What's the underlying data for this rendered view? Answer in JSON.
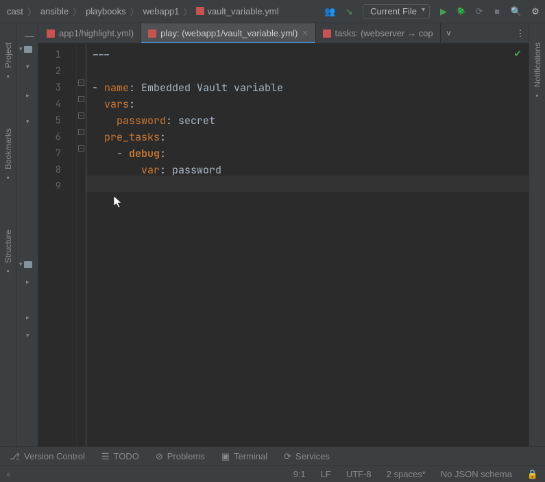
{
  "breadcrumbs": [
    "cast",
    "ansible",
    "playbooks",
    "webapp1",
    "vault_variable.yml"
  ],
  "run_config": "Current File",
  "tabs": [
    {
      "label": "app1/highlight.yml)",
      "active": false
    },
    {
      "label": "play: (webapp1/vault_variable.yml)",
      "active": true
    },
    {
      "label": "tasks: (webserver → cop",
      "active": false
    }
  ],
  "left_tools": [
    "Project",
    "Bookmarks",
    "Structure"
  ],
  "right_tools": [
    "Notifications"
  ],
  "code_lines": [
    {
      "n": 1,
      "tokens": [
        {
          "cls": "tok-dash",
          "t": "---"
        }
      ]
    },
    {
      "n": 2,
      "tokens": []
    },
    {
      "n": 3,
      "fold": true,
      "tokens": [
        {
          "cls": "tok-dash",
          "t": "- "
        },
        {
          "cls": "tok-key",
          "t": "name"
        },
        {
          "cls": "tok-val",
          "t": ": Embedded Vault variable"
        }
      ]
    },
    {
      "n": 4,
      "fold": true,
      "tokens": [
        {
          "cls": "tok-dash",
          "t": "  "
        },
        {
          "cls": "tok-key",
          "t": "vars"
        },
        {
          "cls": "tok-val",
          "t": ":"
        }
      ]
    },
    {
      "n": 5,
      "fold": true,
      "tokens": [
        {
          "cls": "tok-dash",
          "t": "    "
        },
        {
          "cls": "tok-key",
          "t": "password"
        },
        {
          "cls": "tok-val",
          "t": ": secret"
        }
      ]
    },
    {
      "n": 6,
      "fold": true,
      "tokens": [
        {
          "cls": "tok-dash",
          "t": "  "
        },
        {
          "cls": "tok-key",
          "t": "pre_tasks"
        },
        {
          "cls": "tok-val",
          "t": ":"
        }
      ]
    },
    {
      "n": 7,
      "fold": true,
      "tokens": [
        {
          "cls": "tok-dash",
          "t": "    - "
        },
        {
          "cls": "tok-keyb",
          "t": "debug"
        },
        {
          "cls": "tok-val",
          "t": ":"
        }
      ]
    },
    {
      "n": 8,
      "tokens": [
        {
          "cls": "tok-dash",
          "t": "        "
        },
        {
          "cls": "tok-key",
          "t": "var"
        },
        {
          "cls": "tok-val",
          "t": ": password"
        }
      ]
    },
    {
      "n": 9,
      "tokens": [],
      "current": true
    }
  ],
  "bottom_tools": [
    {
      "icon": "⎇",
      "label": "Version Control"
    },
    {
      "icon": "☰",
      "label": "TODO"
    },
    {
      "icon": "⊘",
      "label": "Problems"
    },
    {
      "icon": "▣",
      "label": "Terminal"
    },
    {
      "icon": "⟳",
      "label": "Services"
    }
  ],
  "status": {
    "pos": "9:1",
    "eol": "LF",
    "enc": "UTF-8",
    "indent": "2 spaces*",
    "schema": "No JSON schema"
  }
}
